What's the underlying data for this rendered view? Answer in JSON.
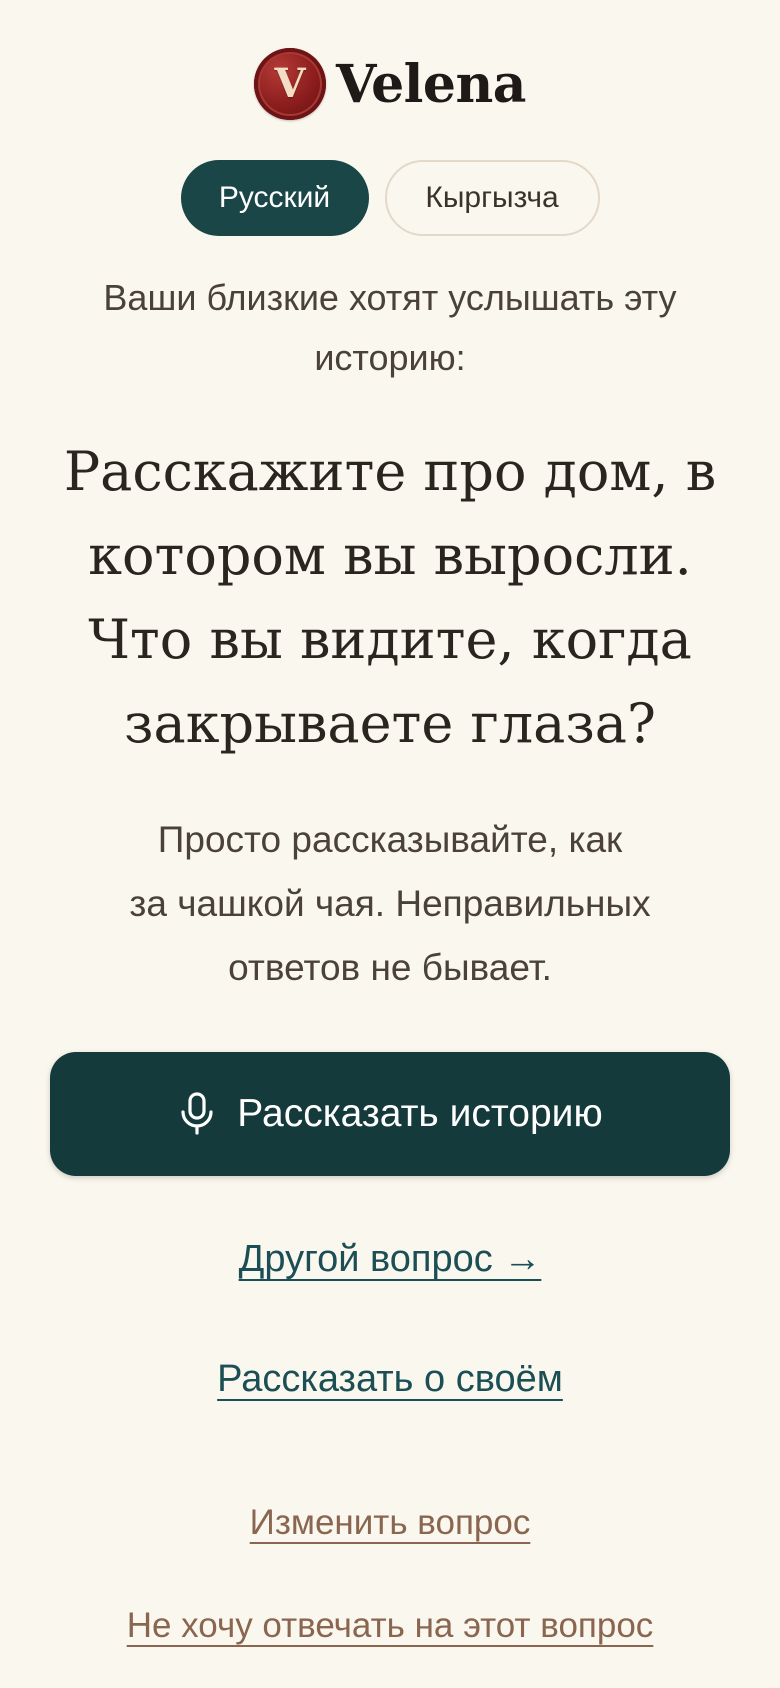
{
  "brand": {
    "seal_letter": "V",
    "name": "Velena"
  },
  "languages": {
    "active": "Русский",
    "other": "Кыргызча"
  },
  "intro": "Ваши близкие хотят услышать эту историю:",
  "question": "Расскажите про дом, в котором вы выросли. Что вы видите, когда закрываете глаза?",
  "reassurance": {
    "line1": "Просто рассказывайте, как",
    "line2": "за чашкой чая. Неправильных",
    "line3": "ответов не бывает."
  },
  "record_button": {
    "icon": "microphone-icon",
    "label": "Рассказать историю"
  },
  "links": {
    "another_question": "Другой вопрос →",
    "tell_own": "Рассказать о своём",
    "change_question": "Изменить вопрос",
    "skip_question": "Не хочу отвечать на этот вопрос"
  },
  "colors": {
    "background": "#FAF7EF",
    "primary": "#143A3C",
    "link_primary": "#1B4F55",
    "link_secondary": "#8A6650",
    "seal": "#8A1C1C"
  }
}
